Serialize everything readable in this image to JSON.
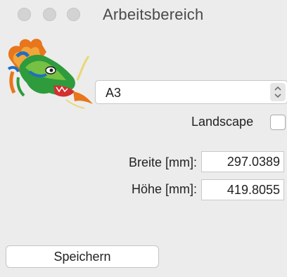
{
  "window": {
    "title": "Arbeitsbereich"
  },
  "paper": {
    "selected": "A3"
  },
  "landscape": {
    "label": "Landscape",
    "checked": false
  },
  "fields": {
    "breite": {
      "label": "Breite [mm]:",
      "value": "297.0389"
    },
    "hoehe": {
      "label": "Höhe [mm]:",
      "value": "419.8055"
    }
  },
  "buttons": {
    "save": "Speichern"
  },
  "icons": {
    "close": "window-close-icon",
    "minimize": "window-minimize-icon",
    "zoom": "window-zoom-icon",
    "select_arrows": "chevron-up-down-icon",
    "logo": "dragon-logo"
  }
}
